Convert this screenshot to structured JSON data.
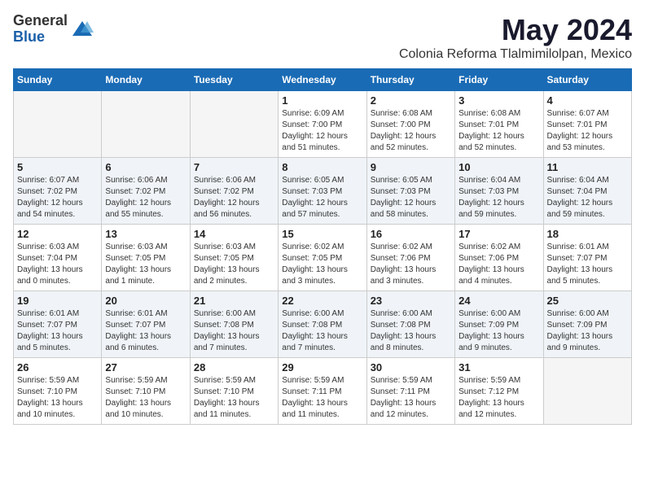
{
  "logo": {
    "general": "General",
    "blue": "Blue"
  },
  "title": "May 2024",
  "location": "Colonia Reforma Tlalmimilolpan, Mexico",
  "days_of_week": [
    "Sunday",
    "Monday",
    "Tuesday",
    "Wednesday",
    "Thursday",
    "Friday",
    "Saturday"
  ],
  "weeks": [
    [
      {
        "day": "",
        "info": ""
      },
      {
        "day": "",
        "info": ""
      },
      {
        "day": "",
        "info": ""
      },
      {
        "day": "1",
        "info": "Sunrise: 6:09 AM\nSunset: 7:00 PM\nDaylight: 12 hours and 51 minutes."
      },
      {
        "day": "2",
        "info": "Sunrise: 6:08 AM\nSunset: 7:00 PM\nDaylight: 12 hours and 52 minutes."
      },
      {
        "day": "3",
        "info": "Sunrise: 6:08 AM\nSunset: 7:01 PM\nDaylight: 12 hours and 52 minutes."
      },
      {
        "day": "4",
        "info": "Sunrise: 6:07 AM\nSunset: 7:01 PM\nDaylight: 12 hours and 53 minutes."
      }
    ],
    [
      {
        "day": "5",
        "info": "Sunrise: 6:07 AM\nSunset: 7:02 PM\nDaylight: 12 hours and 54 minutes."
      },
      {
        "day": "6",
        "info": "Sunrise: 6:06 AM\nSunset: 7:02 PM\nDaylight: 12 hours and 55 minutes."
      },
      {
        "day": "7",
        "info": "Sunrise: 6:06 AM\nSunset: 7:02 PM\nDaylight: 12 hours and 56 minutes."
      },
      {
        "day": "8",
        "info": "Sunrise: 6:05 AM\nSunset: 7:03 PM\nDaylight: 12 hours and 57 minutes."
      },
      {
        "day": "9",
        "info": "Sunrise: 6:05 AM\nSunset: 7:03 PM\nDaylight: 12 hours and 58 minutes."
      },
      {
        "day": "10",
        "info": "Sunrise: 6:04 AM\nSunset: 7:03 PM\nDaylight: 12 hours and 59 minutes."
      },
      {
        "day": "11",
        "info": "Sunrise: 6:04 AM\nSunset: 7:04 PM\nDaylight: 12 hours and 59 minutes."
      }
    ],
    [
      {
        "day": "12",
        "info": "Sunrise: 6:03 AM\nSunset: 7:04 PM\nDaylight: 13 hours and 0 minutes."
      },
      {
        "day": "13",
        "info": "Sunrise: 6:03 AM\nSunset: 7:05 PM\nDaylight: 13 hours and 1 minute."
      },
      {
        "day": "14",
        "info": "Sunrise: 6:03 AM\nSunset: 7:05 PM\nDaylight: 13 hours and 2 minutes."
      },
      {
        "day": "15",
        "info": "Sunrise: 6:02 AM\nSunset: 7:05 PM\nDaylight: 13 hours and 3 minutes."
      },
      {
        "day": "16",
        "info": "Sunrise: 6:02 AM\nSunset: 7:06 PM\nDaylight: 13 hours and 3 minutes."
      },
      {
        "day": "17",
        "info": "Sunrise: 6:02 AM\nSunset: 7:06 PM\nDaylight: 13 hours and 4 minutes."
      },
      {
        "day": "18",
        "info": "Sunrise: 6:01 AM\nSunset: 7:07 PM\nDaylight: 13 hours and 5 minutes."
      }
    ],
    [
      {
        "day": "19",
        "info": "Sunrise: 6:01 AM\nSunset: 7:07 PM\nDaylight: 13 hours and 5 minutes."
      },
      {
        "day": "20",
        "info": "Sunrise: 6:01 AM\nSunset: 7:07 PM\nDaylight: 13 hours and 6 minutes."
      },
      {
        "day": "21",
        "info": "Sunrise: 6:00 AM\nSunset: 7:08 PM\nDaylight: 13 hours and 7 minutes."
      },
      {
        "day": "22",
        "info": "Sunrise: 6:00 AM\nSunset: 7:08 PM\nDaylight: 13 hours and 7 minutes."
      },
      {
        "day": "23",
        "info": "Sunrise: 6:00 AM\nSunset: 7:08 PM\nDaylight: 13 hours and 8 minutes."
      },
      {
        "day": "24",
        "info": "Sunrise: 6:00 AM\nSunset: 7:09 PM\nDaylight: 13 hours and 9 minutes."
      },
      {
        "day": "25",
        "info": "Sunrise: 6:00 AM\nSunset: 7:09 PM\nDaylight: 13 hours and 9 minutes."
      }
    ],
    [
      {
        "day": "26",
        "info": "Sunrise: 5:59 AM\nSunset: 7:10 PM\nDaylight: 13 hours and 10 minutes."
      },
      {
        "day": "27",
        "info": "Sunrise: 5:59 AM\nSunset: 7:10 PM\nDaylight: 13 hours and 10 minutes."
      },
      {
        "day": "28",
        "info": "Sunrise: 5:59 AM\nSunset: 7:10 PM\nDaylight: 13 hours and 11 minutes."
      },
      {
        "day": "29",
        "info": "Sunrise: 5:59 AM\nSunset: 7:11 PM\nDaylight: 13 hours and 11 minutes."
      },
      {
        "day": "30",
        "info": "Sunrise: 5:59 AM\nSunset: 7:11 PM\nDaylight: 13 hours and 12 minutes."
      },
      {
        "day": "31",
        "info": "Sunrise: 5:59 AM\nSunset: 7:12 PM\nDaylight: 13 hours and 12 minutes."
      },
      {
        "day": "",
        "info": ""
      }
    ]
  ]
}
